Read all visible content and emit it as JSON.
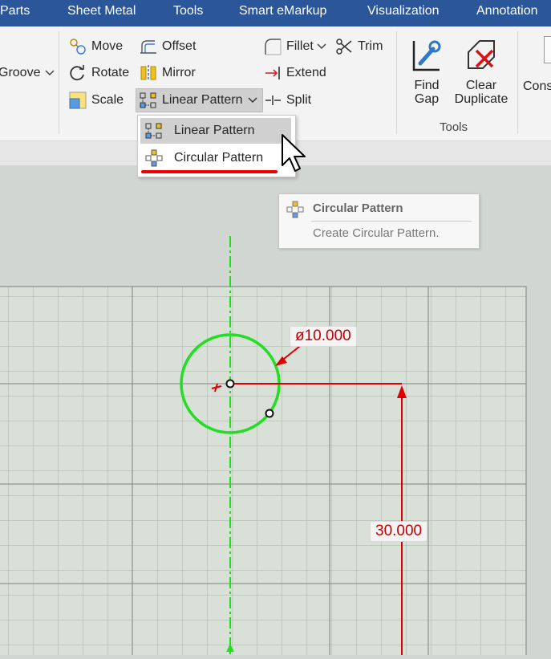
{
  "menubar": {
    "items": [
      "Parts",
      "Sheet Metal",
      "Tools",
      "Smart eMarkup",
      "Visualization",
      "Annotation"
    ]
  },
  "ribbon": {
    "groove_label": "Groove",
    "move_label": "Move",
    "rotate_label": "Rotate",
    "scale_label": "Scale",
    "offset_label": "Offset",
    "mirror_label": "Mirror",
    "linear_pattern_label": "Linear Pattern",
    "fillet_label": "Fillet",
    "extend_label": "Extend",
    "split_label": "Split",
    "trim_label": "Trim",
    "find_gap_line1": "Find",
    "find_gap_line2": "Gap",
    "clear_duplicate_line1": "Clear",
    "clear_duplicate_line2": "Duplicate",
    "tools_group_label": "Tools",
    "cons_label": "Cons"
  },
  "dropdown": {
    "items": [
      "Linear Pattern",
      "Circular Pattern"
    ]
  },
  "tooltip": {
    "title": "Circular Pattern",
    "description": "Create Circular Pattern."
  },
  "sketch": {
    "diameter_label": "ø10.000",
    "distance_label": "30.000"
  },
  "colors": {
    "menubar": "#2b579a",
    "sketch_green": "#22dd22",
    "dimension_red": "#dd0000",
    "grid_bg": "#d9e0d8"
  }
}
